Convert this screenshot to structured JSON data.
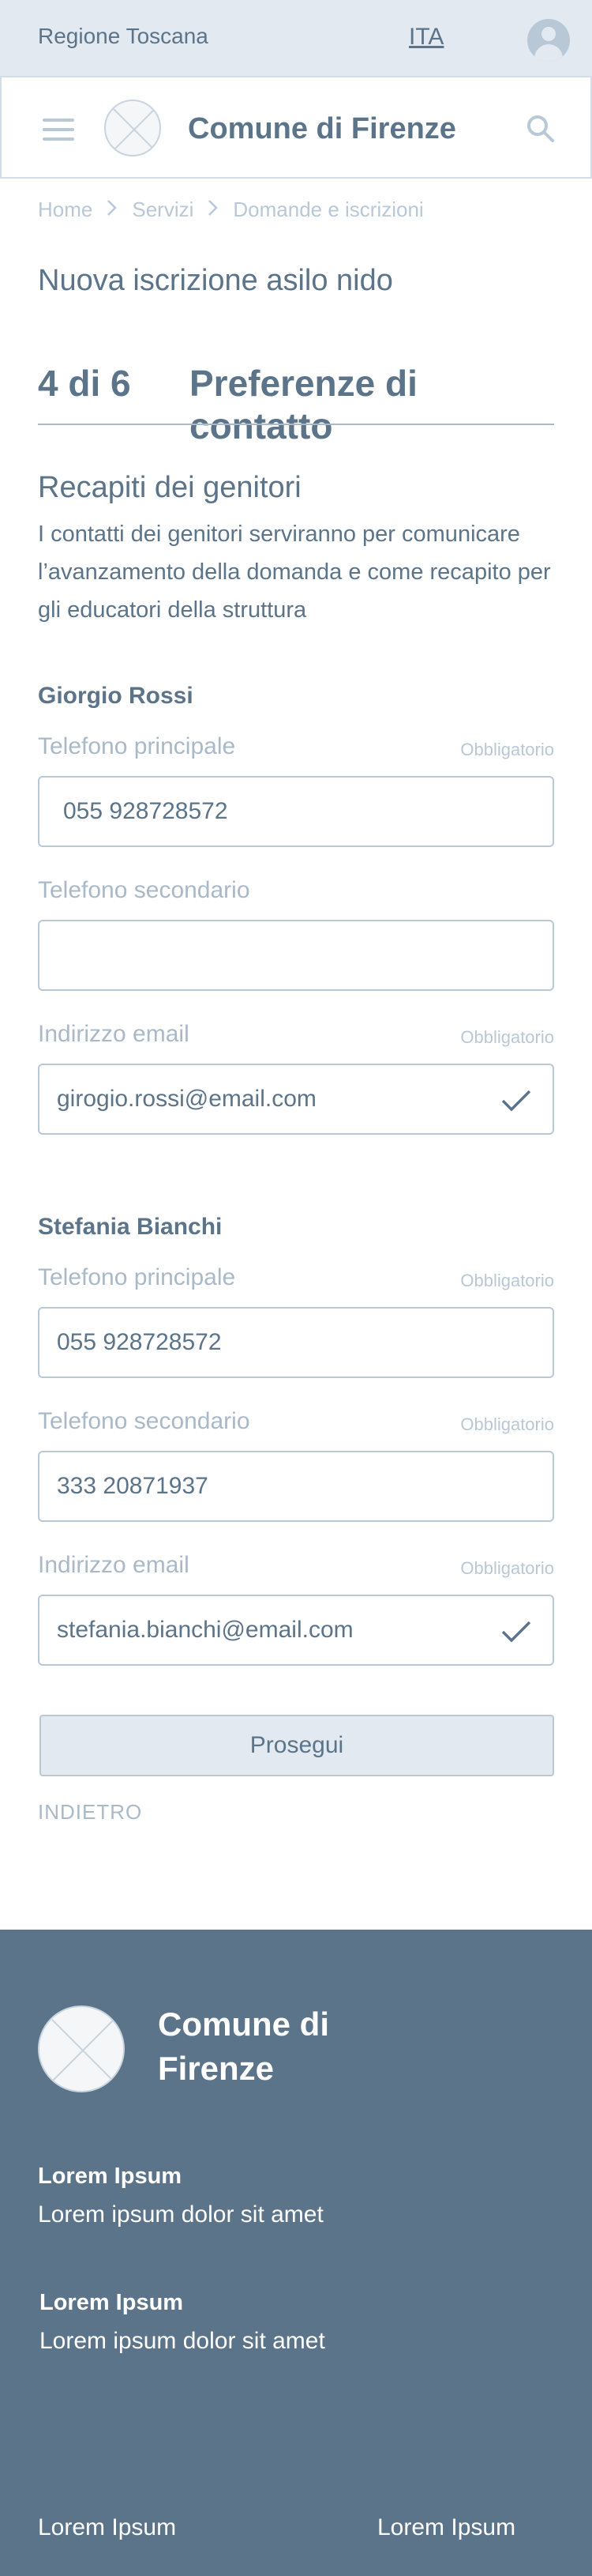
{
  "topbar": {
    "region": "Regione Toscana",
    "language": "ITA",
    "user_icon": "user-avatar-icon"
  },
  "header": {
    "menu_icon": "hamburger-menu-icon",
    "logo_icon": "placeholder-logo-icon",
    "title": "Comune di Firenze",
    "search_icon": "search-icon"
  },
  "breadcrumb": {
    "items": [
      "Home",
      "Servizi",
      "Domande e iscrizioni"
    ]
  },
  "page_title": "Nuova iscrizione asilo nido",
  "step": {
    "count": "4 di 6",
    "name": "Preferenze di contatto"
  },
  "section": {
    "title": "Recapiti dei genitori",
    "description": "I contatti dei genitori serviranno per comunicare l’avanzamento della domanda e come recapito per gli educatori della struttura"
  },
  "parents": [
    {
      "name": "Giorgio Rossi",
      "fields": [
        {
          "label": "Telefono principale",
          "required": "Obbligatorio",
          "value": "055 928728572",
          "valid": false
        },
        {
          "label": "Telefono secondario",
          "required": "",
          "value": "",
          "valid": false
        },
        {
          "label": "Indirizzo email",
          "required": "Obbligatorio",
          "value": "girogio.rossi@email.com",
          "valid": true
        }
      ]
    },
    {
      "name": "Stefania Bianchi",
      "fields": [
        {
          "label": "Telefono principale",
          "required": "Obbligatorio",
          "value": "055 928728572",
          "valid": false
        },
        {
          "label": "Telefono secondario",
          "required": "Obbligatorio",
          "value": "333 20871937",
          "valid": false
        },
        {
          "label": "Indirizzo email",
          "required": "Obbligatorio",
          "value": "stefania.bianchi@email.com",
          "valid": true
        }
      ]
    }
  ],
  "actions": {
    "next": "Prosegui",
    "back": "INDIETRO"
  },
  "footer": {
    "title": "Comune di Firenze",
    "blocks": [
      {
        "heading": "Lorem Ipsum",
        "text": "Lorem ipsum dolor sit amet"
      },
      {
        "heading": "Lorem Ipsum",
        "text": "Lorem ipsum dolor sit amet"
      }
    ],
    "links": [
      "Lorem Ipsum",
      "Lorem Ipsum"
    ]
  },
  "colors": {
    "text": "#5c7489",
    "muted": "#a9b9c8",
    "border": "#b9c8d6",
    "topbar_bg": "#e3e9f0",
    "footer_bg": "#5b7489"
  }
}
